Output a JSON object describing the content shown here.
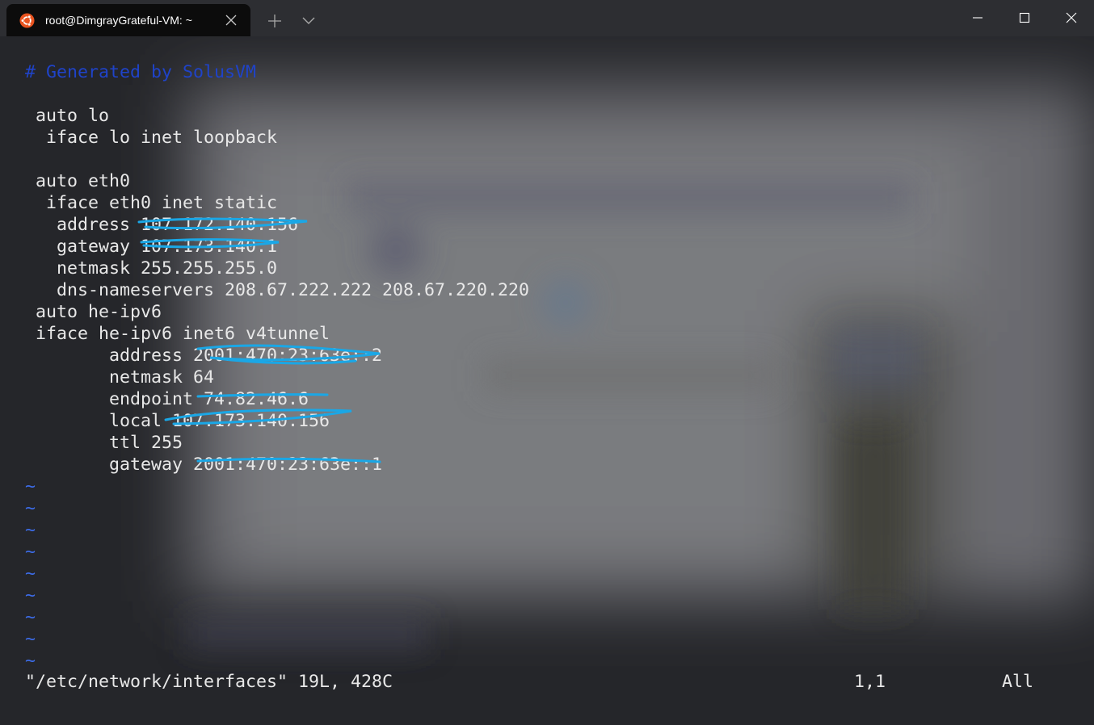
{
  "tab": {
    "title": "root@DimgrayGrateful-VM: ~",
    "icon": "ubuntu-logo-icon"
  },
  "window_controls": [
    "minimize-icon",
    "maximize-icon",
    "close-icon"
  ],
  "colors": {
    "comment": "#1f43c9",
    "tilde": "#3c6be6",
    "text": "#e8e8e8",
    "redaction": "#1aa7e6",
    "ubuntu": "#e95420"
  },
  "file_lines": [
    "# Generated by SolusVM",
    "",
    " auto lo",
    "  iface lo inet loopback",
    "",
    " auto eth0",
    "  iface eth0 inet static",
    "   address 107.172.140.156",
    "   gateway 107.173.140.1",
    "   netmask 255.255.255.0",
    "   dns-nameservers 208.67.222.222 208.67.220.220",
    " auto he-ipv6",
    " iface he-ipv6 inet6 v4tunnel",
    "        address 2001:470:23:63e::2",
    "        netmask 64",
    "        endpoint 74.82.46.6",
    "        local 107.173.140.156",
    "        ttl 255",
    "        gateway 2001:470:23:63e::1"
  ],
  "empty_lines": [
    "~",
    "~",
    "~",
    "~",
    "~",
    "~",
    "~",
    "~",
    "~"
  ],
  "status": {
    "file": "\"/etc/network/interfaces\" 19L, 428C",
    "position": "1,1",
    "scroll": "All"
  }
}
